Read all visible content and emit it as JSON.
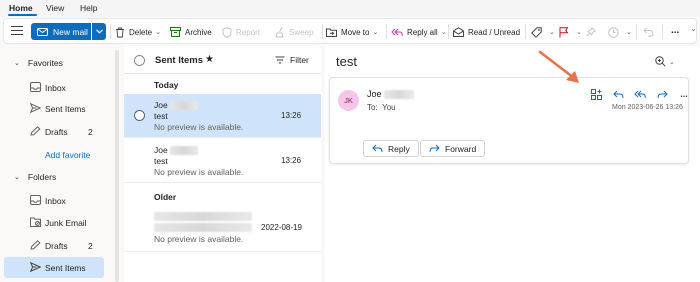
{
  "tabs": [
    {
      "label": "Home"
    },
    {
      "label": "View"
    },
    {
      "label": "Help"
    }
  ],
  "ribbon": {
    "new_mail": "New mail",
    "delete": "Delete",
    "archive": "Archive",
    "report": "Report",
    "sweep": "Sweep",
    "move_to": "Move to",
    "reply_all": "Reply all",
    "read_unread": "Read / Unread",
    "more": "..."
  },
  "nav": {
    "favorites": {
      "label": "Favorites",
      "items": [
        {
          "label": "Inbox",
          "count": ""
        },
        {
          "label": "Sent Items",
          "count": ""
        },
        {
          "label": "Drafts",
          "count": "2"
        }
      ],
      "add": "Add favorite"
    },
    "folders": {
      "label": "Folders",
      "items": [
        {
          "label": "Inbox",
          "count": ""
        },
        {
          "label": "Junk Email",
          "count": ""
        },
        {
          "label": "Drafts",
          "count": "2"
        },
        {
          "label": "Sent Items",
          "count": ""
        }
      ]
    }
  },
  "list": {
    "title": "Sent Items",
    "filter": "Filter",
    "groups": {
      "today": "Today",
      "older": "Older"
    },
    "messages": [
      {
        "from": "Joe",
        "subject": "test",
        "preview": "No preview is available.",
        "time": "13:26"
      },
      {
        "from": "Joe",
        "subject": "test",
        "preview": "No preview is available.",
        "time": "13:26"
      },
      {
        "from": "",
        "subject": "",
        "preview": "No preview is available.",
        "time": "2022-08-19"
      }
    ]
  },
  "reading": {
    "subject": "test",
    "avatar_initials": "JK",
    "from": "Joe",
    "to_label": "To:",
    "to_value": "You",
    "date": "Mon 2023-06-26 13:26",
    "reply": "Reply",
    "forward": "Forward",
    "more": "..."
  },
  "colors": {
    "accent": "#0f6cbd",
    "selected": "#cfe4fa",
    "arrow": "#e8734a",
    "avatar_bg": "#f7c5e5"
  }
}
